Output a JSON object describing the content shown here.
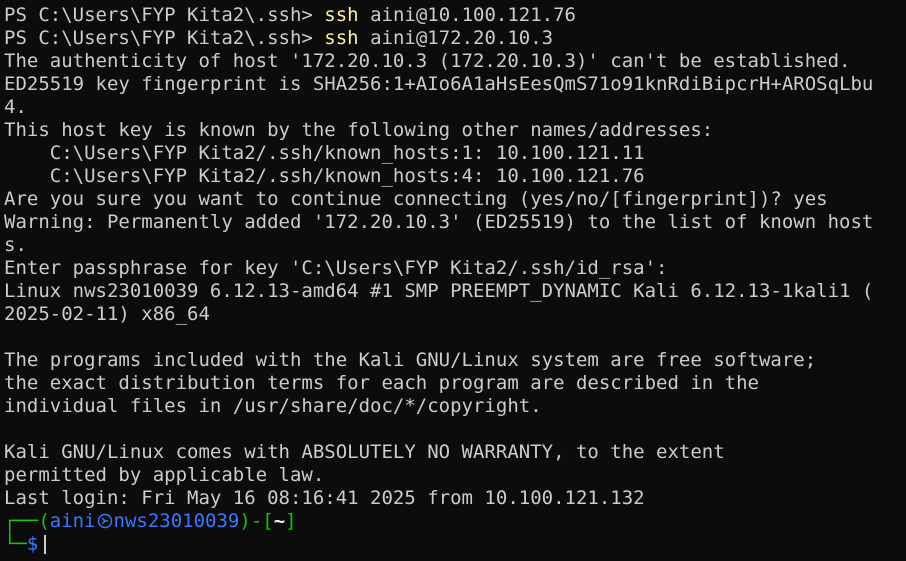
{
  "terminal": {
    "line1": {
      "prefix": "PS C:\\Users\\FYP Kita2\\.ssh> ",
      "command": "ssh",
      "args": " aini@10.100.121.76"
    },
    "line2": {
      "prefix": "PS C:\\Users\\FYP Kita2\\.ssh> ",
      "command": "ssh",
      "args": " aini@172.20.10.3"
    },
    "output": [
      "The authenticity of host '172.20.10.3 (172.20.10.3)' can't be established.",
      "ED25519 key fingerprint is SHA256:1+AIo6A1aHsEesQmS71o91knRdiBipcrH+AROSqLbu",
      "4.",
      "This host key is known by the following other names/addresses:",
      "    C:\\Users\\FYP Kita2/.ssh/known_hosts:1: 10.100.121.11",
      "    C:\\Users\\FYP Kita2/.ssh/known_hosts:4: 10.100.121.76",
      "Are you sure you want to continue connecting (yes/no/[fingerprint])? yes",
      "Warning: Permanently added '172.20.10.3' (ED25519) to the list of known host",
      "s.",
      "Enter passphrase for key 'C:\\Users\\FYP Kita2/.ssh/id_rsa':",
      "Linux nws23010039 6.12.13-amd64 #1 SMP PREEMPT_DYNAMIC Kali 6.12.13-1kali1 (",
      "2025-02-11) x86_64",
      "",
      "The programs included with the Kali GNU/Linux system are free software;",
      "the exact distribution terms for each program are described in the",
      "individual files in /usr/share/doc/*/copyright.",
      "",
      "Kali GNU/Linux comes with ABSOLUTELY NO WARRANTY, to the extent",
      "permitted by applicable law.",
      "Last login: Fri May 16 08:16:41 2025 from 10.100.121.132"
    ],
    "prompt": {
      "frame_top": "┌──(",
      "user": "aini",
      "host": "nws23010039",
      "mid": ")-[",
      "path": "~",
      "end": "]",
      "frame_bottom": "└─",
      "symbol": "$"
    }
  },
  "colors": {
    "background": "#0c0c0c",
    "text": "#cccccc",
    "command": "#f9f1a5",
    "frame": "#16c60c",
    "user_host": "#3b78ff",
    "path": "#f2f2f2"
  }
}
